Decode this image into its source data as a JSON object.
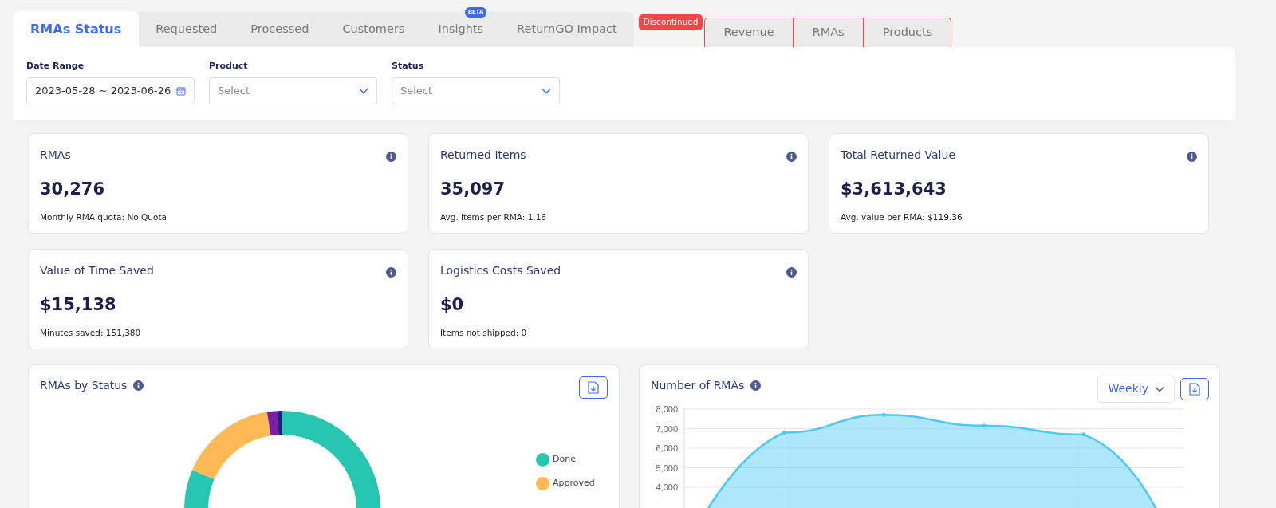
{
  "tabs": [
    {
      "label": "RMAs Status",
      "selected": true
    },
    {
      "label": "Requested",
      "selected": false
    },
    {
      "label": "Processed",
      "selected": false
    },
    {
      "label": "Customers",
      "selected": false
    },
    {
      "label": "Insights",
      "selected": false,
      "badge": "BETA"
    },
    {
      "label": "ReturnGO Impact",
      "selected": false
    }
  ],
  "discontinued": {
    "badge": "Discontinued",
    "tabs": [
      {
        "label": "Revenue",
        "selected": false
      },
      {
        "label": "RMAs",
        "selected": false
      },
      {
        "label": "Products",
        "selected": false
      }
    ]
  },
  "filters": [
    {
      "label": "Date Range",
      "kind": "date",
      "value": "2023-05-28 ~ 2023-06-26"
    },
    {
      "label": "Product",
      "kind": "select",
      "placeholder": "Select"
    },
    {
      "label": "Status",
      "kind": "select",
      "placeholder": "Select"
    }
  ],
  "stats": [
    {
      "title": "RMAs",
      "value": "30,276",
      "note": "Monthly RMA quota: No Quota"
    },
    {
      "title": "Returned Items",
      "value": "35,097",
      "note": "Avg. items per RMA: 1.16"
    },
    {
      "title": "Total Returned Value",
      "value": "$3,613,643",
      "note": "Avg. value per RMA: $119.36"
    },
    {
      "title": "Value of Time Saved",
      "value": "$15,138",
      "note": "Minutes saved: 151,380"
    },
    {
      "title": "Logistics Costs Saved",
      "value": "$0",
      "note": "Items not shipped: 0"
    }
  ],
  "status_chart": {
    "title": "RMAs by Status",
    "legend": [
      {
        "label": "Done",
        "color": "#26c6b0"
      },
      {
        "label": "Approved",
        "color": "#ffb955"
      }
    ]
  },
  "rma_chart": {
    "title": "Number of RMAs",
    "period": "Weekly",
    "chart_data": {
      "type": "area",
      "series": [
        {
          "color": "#4cc9f5",
          "values": [
            null,
            6800,
            7700,
            7150,
            6700,
            null
          ]
        }
      ],
      "grid": true,
      "yticks": [
        {
          "value": 4000,
          "label": "4,000"
        },
        {
          "value": 5000,
          "label": "5,000"
        },
        {
          "value": 6000,
          "label": "6,000"
        },
        {
          "value": 7000,
          "label": "7,000"
        },
        {
          "value": 8000,
          "label": "8,000"
        }
      ],
      "ylim": [
        4000,
        8000
      ]
    }
  }
}
